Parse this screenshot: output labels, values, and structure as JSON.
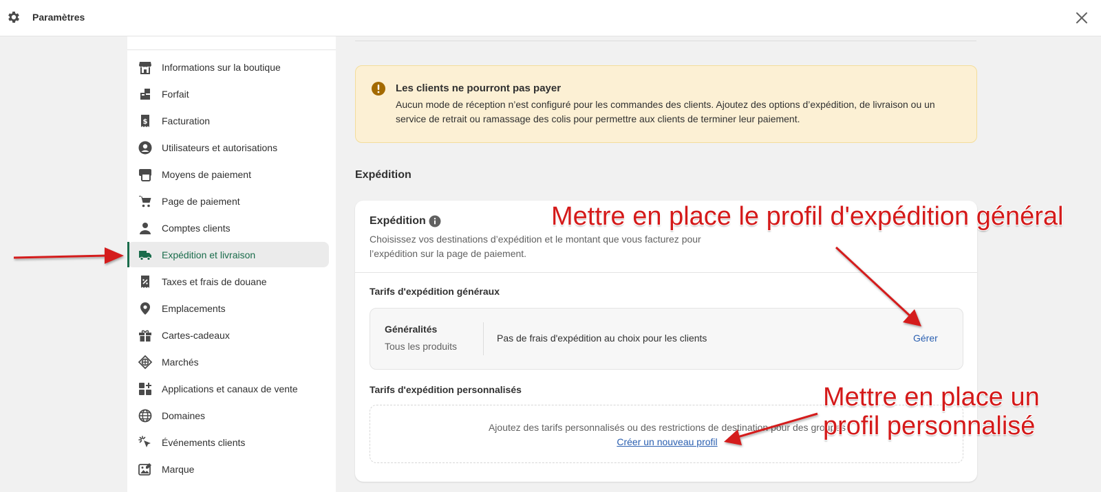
{
  "topbar": {
    "title": "Paramètres",
    "icon": "gear-icon",
    "close_icon": "close-icon"
  },
  "sidebar": {
    "items": [
      {
        "label": "Informations sur la boutique",
        "icon": "store-icon"
      },
      {
        "label": "Forfait",
        "icon": "plan-icon"
      },
      {
        "label": "Facturation",
        "icon": "billing-icon"
      },
      {
        "label": "Utilisateurs et autorisations",
        "icon": "user-circle-icon"
      },
      {
        "label": "Moyens de paiement",
        "icon": "payments-icon"
      },
      {
        "label": "Page de paiement",
        "icon": "cart-icon"
      },
      {
        "label": "Comptes clients",
        "icon": "person-icon"
      },
      {
        "label": "Expédition et livraison",
        "icon": "truck-icon",
        "active": true
      },
      {
        "label": "Taxes et frais de douane",
        "icon": "tax-icon"
      },
      {
        "label": "Emplacements",
        "icon": "location-pin-icon"
      },
      {
        "label": "Cartes-cadeaux",
        "icon": "gift-icon"
      },
      {
        "label": "Marchés",
        "icon": "globe-markets-icon"
      },
      {
        "label": "Applications et canaux de vente",
        "icon": "apps-icon"
      },
      {
        "label": "Domaines",
        "icon": "globe-icon"
      },
      {
        "label": "Événements clients",
        "icon": "cursor-click-icon"
      },
      {
        "label": "Marque",
        "icon": "brand-image-icon"
      }
    ],
    "accent_color": "#1a6c4b"
  },
  "banner": {
    "icon": "alert-icon",
    "title": "Les clients ne pourront pas payer",
    "text": "Aucun mode de réception n’est configuré pour les commandes des clients. Ajoutez des options d’expédition, de livraison ou un service de retrait ou ramassage des colis pour permettre aux clients de terminer leur paiement.",
    "bg_color": "#fcf0d4"
  },
  "main": {
    "section_title": "Expédition"
  },
  "card": {
    "title": "Expédition",
    "info_icon": "info-icon",
    "description": "Choisissez vos destinations d’expédition et le montant que vous facturez pour l’expédition sur la page de paiement.",
    "general_rates_title": "Tarifs d'expédition généraux",
    "general_profile": {
      "name": "Généralités",
      "scope": "Tous les produits",
      "description": "Pas de frais d'expédition au choix pour les clients",
      "manage_label": "Gérer"
    },
    "custom_rates_title": "Tarifs d'expédition personnalisés",
    "custom_box": {
      "text": "Ajoutez des tarifs personnalisés ou des restrictions de destination pour des groupes",
      "link_label": "Créer un nouveau profil"
    }
  },
  "annotations": {
    "general": "Mettre en place le profil d'expédition général",
    "custom_line1": "Mettre en place un",
    "custom_line2": "profil personnalisé",
    "color": "#d41a1a"
  }
}
